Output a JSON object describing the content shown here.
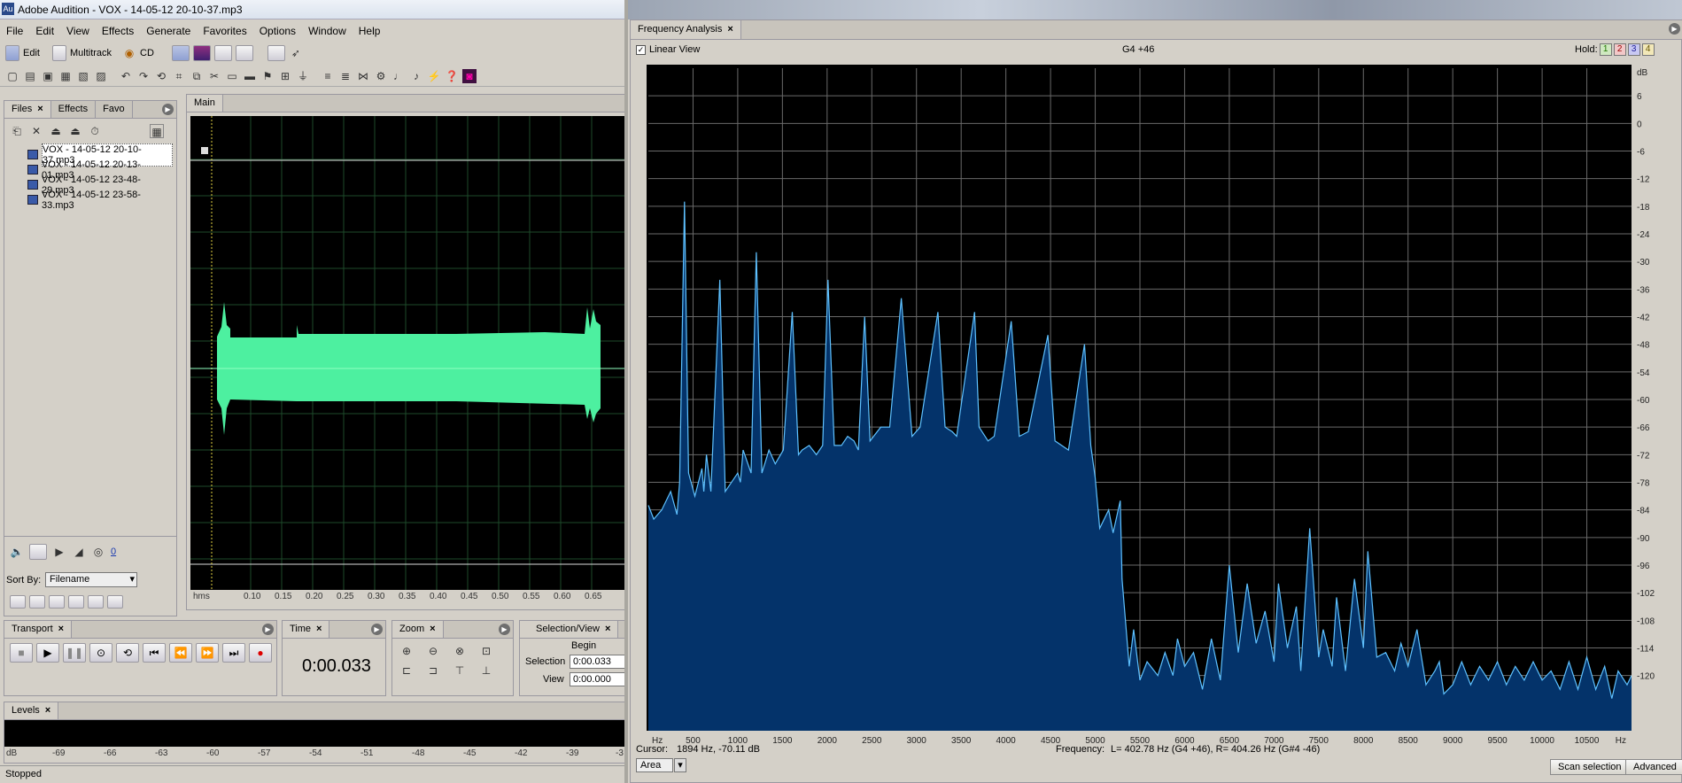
{
  "window": {
    "title": "Adobe Audition - VOX - 14-05-12  20-10-37.mp3",
    "app_icon": "Au"
  },
  "menu": [
    "File",
    "Edit",
    "View",
    "Effects",
    "Generate",
    "Favorites",
    "Options",
    "Window",
    "Help"
  ],
  "modes": {
    "edit": "Edit",
    "multitrack": "Multitrack",
    "cd": "CD"
  },
  "files_panel": {
    "tabs": [
      "Files",
      "Effects",
      "Favo"
    ],
    "files": [
      "VOX - 14-05-12  20-10-37.mp3",
      "VOX - 14-05-12  20-13-01.mp3",
      "VOX - 14-05-12  23-48-29.mp3",
      "VOX - 14-05-12  23-58-33.mp3"
    ],
    "sort_label": "Sort By:",
    "sort_value": "Filename",
    "counter": "0"
  },
  "main_panel": {
    "tab": "Main",
    "ruler": {
      "unit": "hms",
      "labels": [
        "0.10",
        "0.15",
        "0.20",
        "0.25",
        "0.30",
        "0.35",
        "0.40",
        "0.45",
        "0.50",
        "0.55",
        "0.60",
        "0.65"
      ]
    }
  },
  "transport": {
    "tab": "Transport"
  },
  "time": {
    "tab": "Time",
    "value": "0:00.033"
  },
  "zoom": {
    "tab": "Zoom"
  },
  "selection_view": {
    "tab": "Selection/View",
    "begin_label": "Begin",
    "selection_label": "Selection",
    "selection_value": "0:00.033",
    "view_label": "View",
    "view_value": "0:00.000"
  },
  "levels": {
    "tab": "Levels",
    "scale": [
      "dB",
      "-69",
      "-66",
      "-63",
      "-60",
      "-57",
      "-54",
      "-51",
      "-48",
      "-45",
      "-42",
      "-39",
      "-3"
    ]
  },
  "status": "Stopped",
  "freq": {
    "tab": "Frequency Analysis",
    "linear_view": "Linear View",
    "note": "G4 +46",
    "hold_label": "Hold:",
    "hold_buttons": [
      "1",
      "2",
      "3",
      "4"
    ],
    "cursor_label": "Cursor:",
    "cursor_value": "1894 Hz, -70.11 dB",
    "frequency_label": "Frequency:",
    "frequency_value": "L= 402.78 Hz (G4 +46), R= 404.26 Hz (G#4 -46)",
    "area_select": "Area",
    "scan_button": "Scan selection",
    "advanced_button": "Advanced",
    "colors": {
      "fill": "#04336a",
      "line": "#5ec1ff",
      "grid": "#6a6a6a"
    }
  },
  "chart_data": {
    "type": "area",
    "xlabel": "Hz",
    "ylabel": "dB",
    "xlim": [
      0,
      11000
    ],
    "ylim": [
      -132,
      12
    ],
    "x_ticks": [
      500,
      1000,
      1500,
      2000,
      2500,
      3000,
      3500,
      4000,
      4500,
      5000,
      5500,
      6000,
      6500,
      7000,
      7500,
      8000,
      8500,
      9000,
      9500,
      10000,
      10500
    ],
    "y_ticks": [
      6,
      0,
      -6,
      -12,
      -18,
      -24,
      -30,
      -36,
      -42,
      -48,
      -54,
      -60,
      -66,
      -72,
      -78,
      -84,
      -90,
      -96,
      -102,
      -108,
      -114,
      -120
    ],
    "grid": true,
    "peaks": [
      [
        0,
        -83
      ],
      [
        60,
        -86
      ],
      [
        150,
        -84
      ],
      [
        250,
        -80
      ],
      [
        320,
        -85
      ],
      [
        350,
        -78
      ],
      [
        404,
        -17
      ],
      [
        450,
        -76
      ],
      [
        520,
        -81
      ],
      [
        600,
        -75
      ],
      [
        620,
        -80
      ],
      [
        650,
        -72
      ],
      [
        700,
        -80
      ],
      [
        800,
        -34
      ],
      [
        860,
        -80
      ],
      [
        1000,
        -76
      ],
      [
        1030,
        -78
      ],
      [
        1060,
        -71
      ],
      [
        1150,
        -76
      ],
      [
        1208,
        -28
      ],
      [
        1270,
        -76
      ],
      [
        1350,
        -71
      ],
      [
        1420,
        -74
      ],
      [
        1480,
        -72
      ],
      [
        1510,
        -71
      ],
      [
        1610,
        -41
      ],
      [
        1680,
        -72
      ],
      [
        1720,
        -71
      ],
      [
        1800,
        -70
      ],
      [
        1880,
        -72
      ],
      [
        1950,
        -70
      ],
      [
        2010,
        -34
      ],
      [
        2080,
        -70
      ],
      [
        2160,
        -70
      ],
      [
        2230,
        -68
      ],
      [
        2300,
        -69
      ],
      [
        2350,
        -71
      ],
      [
        2420,
        -42
      ],
      [
        2480,
        -69
      ],
      [
        2600,
        -66
      ],
      [
        2700,
        -66
      ],
      [
        2830,
        -38
      ],
      [
        2950,
        -68
      ],
      [
        3040,
        -66
      ],
      [
        3240,
        -41
      ],
      [
        3320,
        -66
      ],
      [
        3400,
        -67
      ],
      [
        3450,
        -68
      ],
      [
        3650,
        -41
      ],
      [
        3700,
        -66
      ],
      [
        3800,
        -69
      ],
      [
        3870,
        -68
      ],
      [
        4060,
        -43
      ],
      [
        4150,
        -68
      ],
      [
        4250,
        -67
      ],
      [
        4470,
        -46
      ],
      [
        4550,
        -69
      ],
      [
        4700,
        -71
      ],
      [
        4880,
        -48
      ],
      [
        4950,
        -70
      ],
      [
        5000,
        -77
      ],
      [
        5050,
        -88
      ],
      [
        5150,
        -84
      ],
      [
        5200,
        -89
      ],
      [
        5280,
        -82
      ],
      [
        5300,
        -99
      ],
      [
        5380,
        -118
      ],
      [
        5430,
        -110
      ],
      [
        5500,
        -121
      ],
      [
        5580,
        -117
      ],
      [
        5700,
        -120
      ],
      [
        5780,
        -115
      ],
      [
        5870,
        -120
      ],
      [
        5920,
        -112
      ],
      [
        6000,
        -118
      ],
      [
        6100,
        -115
      ],
      [
        6200,
        -123
      ],
      [
        6300,
        -112
      ],
      [
        6400,
        -121
      ],
      [
        6500,
        -96
      ],
      [
        6600,
        -115
      ],
      [
        6700,
        -100
      ],
      [
        6800,
        -113
      ],
      [
        6900,
        -106
      ],
      [
        7000,
        -117
      ],
      [
        7050,
        -100
      ],
      [
        7150,
        -114
      ],
      [
        7250,
        -105
      ],
      [
        7300,
        -119
      ],
      [
        7400,
        -88
      ],
      [
        7500,
        -116
      ],
      [
        7550,
        -110
      ],
      [
        7650,
        -118
      ],
      [
        7700,
        -103
      ],
      [
        7800,
        -119
      ],
      [
        7900,
        -99
      ],
      [
        8000,
        -114
      ],
      [
        8050,
        -93
      ],
      [
        8150,
        -116
      ],
      [
        8250,
        -115
      ],
      [
        8350,
        -119
      ],
      [
        8420,
        -113
      ],
      [
        8500,
        -118
      ],
      [
        8600,
        -110
      ],
      [
        8700,
        -122
      ],
      [
        8800,
        -119
      ],
      [
        8850,
        -117
      ],
      [
        8900,
        -124
      ],
      [
        9000,
        -122
      ],
      [
        9100,
        -117
      ],
      [
        9200,
        -122
      ],
      [
        9300,
        -118
      ],
      [
        9400,
        -121
      ],
      [
        9500,
        -117
      ],
      [
        9600,
        -122
      ],
      [
        9700,
        -118
      ],
      [
        9800,
        -121
      ],
      [
        9900,
        -117
      ],
      [
        10000,
        -121
      ],
      [
        10100,
        -119
      ],
      [
        10200,
        -123
      ],
      [
        10300,
        -117
      ],
      [
        10400,
        -123
      ],
      [
        10500,
        -116
      ],
      [
        10600,
        -123
      ],
      [
        10700,
        -118
      ],
      [
        10780,
        -125
      ],
      [
        10850,
        -119
      ],
      [
        10950,
        -122
      ],
      [
        11000,
        -120
      ]
    ]
  }
}
